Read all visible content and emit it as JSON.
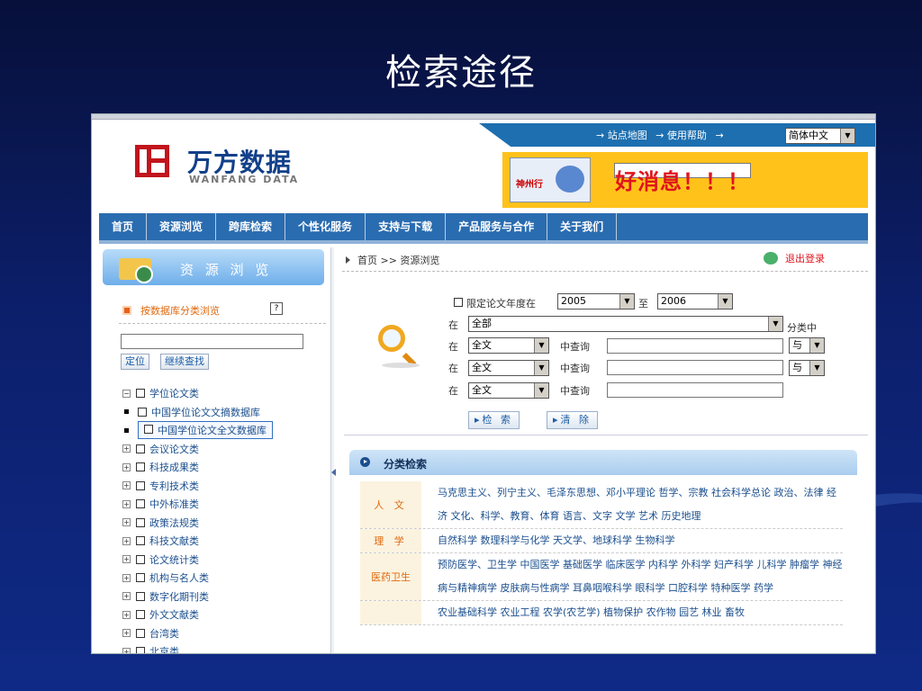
{
  "slide": {
    "title": "检索途径"
  },
  "header": {
    "top_links": [
      "→ 站点地图",
      "→ 使用帮助",
      "→"
    ],
    "language": "简体中文",
    "logo_cn": "万方数据",
    "logo_en": "WANFANG DATA",
    "banner_text": "好消息！！！",
    "banner_pic_text": "神州行"
  },
  "nav": [
    "首页",
    "资源浏览",
    "跨库检索",
    "个性化服务",
    "支持与下载",
    "产品服务与合作",
    "关于我们"
  ],
  "sidebar": {
    "title": "资 源 浏 览",
    "category_link": "按数据库分类浏览",
    "help": "?",
    "search_value": "",
    "locate_btn": "定位",
    "continue_btn": "继续查找",
    "tree": [
      {
        "label": "学位论文类",
        "expanded": true
      },
      {
        "label": "中国学位论文文摘数据库",
        "child": true
      },
      {
        "label": "中国学位论文全文数据库",
        "child": true,
        "selected": true
      },
      {
        "label": "会议论文类"
      },
      {
        "label": "科技成果类"
      },
      {
        "label": "专利技术类"
      },
      {
        "label": "中外标准类"
      },
      {
        "label": "政策法规类"
      },
      {
        "label": "科技文献类"
      },
      {
        "label": "论文统计类"
      },
      {
        "label": "机构与名人类"
      },
      {
        "label": "数字化期刊类"
      },
      {
        "label": "外文文献类"
      },
      {
        "label": "台湾类"
      },
      {
        "label": "北京类"
      }
    ]
  },
  "main": {
    "breadcrumb": "首页 >> 资源浏览",
    "logout": "退出登录",
    "limit_year_label": "限定论文年度在",
    "year_from": "2005",
    "to_label": "至",
    "year_to": "2006",
    "in_label": "在",
    "scope": "全部",
    "scope_suffix": "分类中",
    "field": "全文",
    "query_label": "中查询",
    "logic": "与",
    "search_btn": "▸检 索",
    "clear_btn": "▸清 除",
    "class_title": "分类检索",
    "classes": [
      {
        "name": "人 文",
        "items": "马克思主义、列宁主义、毛泽东思想、邓小平理论 哲学、宗教 社会科学总论 政治、法律 经济 文化、科学、教育、体育 语言、文字 文学 艺术 历史地理"
      },
      {
        "name": "理 学",
        "items": "自然科学 数理科学与化学 天文学、地球科学 生物科学"
      },
      {
        "name": "医药卫生",
        "items": "预防医学、卫生学 中国医学 基础医学 临床医学 内科学 外科学 妇产科学 儿科学 肿瘤学 神经病与精神病学 皮肤病与性病学 耳鼻咽喉科学 眼科学 口腔科学 特种医学 药学"
      },
      {
        "name": "",
        "items": "农业基础科学 农业工程 农学(农艺学) 植物保护 农作物 园艺 林业 畜牧"
      }
    ]
  }
}
